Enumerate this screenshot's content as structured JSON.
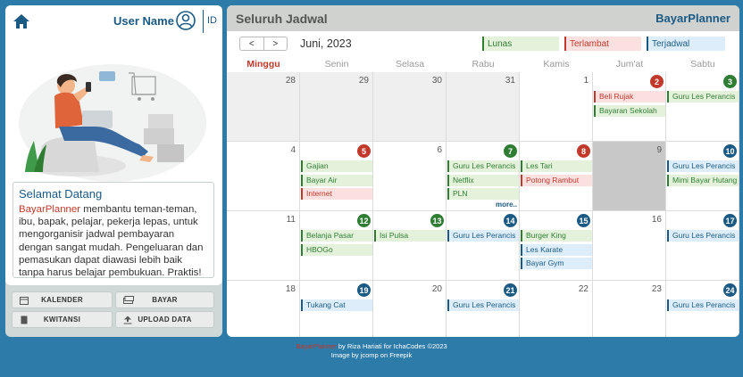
{
  "user": {
    "name": "User Name",
    "lang": "ID"
  },
  "welcome": {
    "title": "Selamat Datang",
    "brand": "BayarPlanner",
    "text": " membantu teman-teman, ibu, bapak, pelajar, pekerja lepas, untuk mengorganisir jadwal pembayaran dengan sangat mudah. Pengeluaran dan pemasukan dapat diawasi lebih baik tanpa harus belajar pembukuan. Praktis!"
  },
  "buttons": [
    {
      "label": "KALENDER",
      "icon": "calendar-icon"
    },
    {
      "label": "BAYAR",
      "icon": "money-icon"
    },
    {
      "label": "KWITANSI",
      "icon": "receipt-icon"
    },
    {
      "label": "UPLOAD DATA",
      "icon": "upload-icon"
    }
  ],
  "header": {
    "title": "Seluruh Jadwal",
    "brand": "BayarPlanner"
  },
  "calendar": {
    "month": "Juni, 2023",
    "prev": "<",
    "next": ">",
    "legend": [
      {
        "label": "Lunas",
        "color": "#2e7d32",
        "bg": "#e4f2dc"
      },
      {
        "label": "Terlambat",
        "color": "#c0392b",
        "bg": "#fbe0e0"
      },
      {
        "label": "Terjadwal",
        "color": "#1b5a84",
        "bg": "#ddeefa"
      }
    ],
    "weekdays": [
      "Minggu",
      "Senin",
      "Selasa",
      "Rabu",
      "Kamis",
      "Jum'at",
      "Sabtu"
    ],
    "weeks": [
      [
        {
          "d": "28",
          "other": true
        },
        {
          "d": "29",
          "other": true
        },
        {
          "d": "30",
          "other": true
        },
        {
          "d": "31",
          "other": true
        },
        {
          "d": "1"
        },
        {
          "d": "2",
          "badge": "r",
          "events": [
            {
              "t": "Beli Rujak",
              "s": "r"
            },
            {
              "t": "Bayaran Sekolah",
              "s": "g"
            }
          ]
        },
        {
          "d": "3",
          "badge": "g",
          "events": [
            {
              "t": "Guru Les Perancis",
              "s": "g"
            }
          ]
        }
      ],
      [
        {
          "d": "4"
        },
        {
          "d": "5",
          "badge": "r",
          "events": [
            {
              "t": "Gajian",
              "s": "g"
            },
            {
              "t": "Bayar Air",
              "s": "g"
            },
            {
              "t": "Internet",
              "s": "r"
            }
          ]
        },
        {
          "d": "6"
        },
        {
          "d": "7",
          "badge": "g",
          "events": [
            {
              "t": "Guru Les Perancis",
              "s": "g"
            },
            {
              "t": "Netflix",
              "s": "g"
            },
            {
              "t": "PLN",
              "s": "g"
            }
          ],
          "more": "more.."
        },
        {
          "d": "8",
          "badge": "r",
          "events": [
            {
              "t": "Les Tari",
              "s": "g"
            },
            {
              "t": "Potong Rambut",
              "s": "r"
            }
          ]
        },
        {
          "d": "9",
          "today": true
        },
        {
          "d": "10",
          "badge": "b",
          "events": [
            {
              "t": "Guru Les Perancis",
              "s": "b"
            },
            {
              "t": "Mimi Bayar Hutang",
              "s": "g"
            }
          ]
        }
      ],
      [
        {
          "d": "11"
        },
        {
          "d": "12",
          "badge": "g",
          "events": [
            {
              "t": "Belanja Pasar",
              "s": "g"
            },
            {
              "t": "HBOGo",
              "s": "g"
            }
          ]
        },
        {
          "d": "13",
          "badge": "g",
          "events": [
            {
              "t": "Isi Pulsa",
              "s": "g"
            }
          ]
        },
        {
          "d": "14",
          "badge": "b",
          "events": [
            {
              "t": "Guru Les Perancis",
              "s": "b"
            }
          ]
        },
        {
          "d": "15",
          "badge": "b",
          "events": [
            {
              "t": "Burger King",
              "s": "g"
            },
            {
              "t": "Les Karate",
              "s": "b"
            },
            {
              "t": "Bayar Gym",
              "s": "b"
            }
          ]
        },
        {
          "d": "16"
        },
        {
          "d": "17",
          "badge": "b",
          "events": [
            {
              "t": "Guru Les Perancis",
              "s": "b"
            }
          ]
        }
      ],
      [
        {
          "d": "18"
        },
        {
          "d": "19",
          "badge": "b",
          "events": [
            {
              "t": "Tukang Cat",
              "s": "b"
            }
          ]
        },
        {
          "d": "20"
        },
        {
          "d": "21",
          "badge": "b",
          "events": [
            {
              "t": "Guru Les Perancis",
              "s": "b"
            }
          ]
        },
        {
          "d": "22"
        },
        {
          "d": "23"
        },
        {
          "d": "24",
          "badge": "b",
          "events": [
            {
              "t": "Guru Les Perancis",
              "s": "b"
            }
          ]
        }
      ]
    ]
  },
  "footer": {
    "brand": "BayarPlanner",
    "line1": " by Riza Hariati for IchaCodes ©2023",
    "line2": "Image by jcomp  on Freepik"
  },
  "colors": {
    "primary": "#1b5a84",
    "lunas": "#2e7d32",
    "terlambat": "#c0392b",
    "terjadwal": "#1b5a84",
    "background": "#2d7ba8"
  }
}
